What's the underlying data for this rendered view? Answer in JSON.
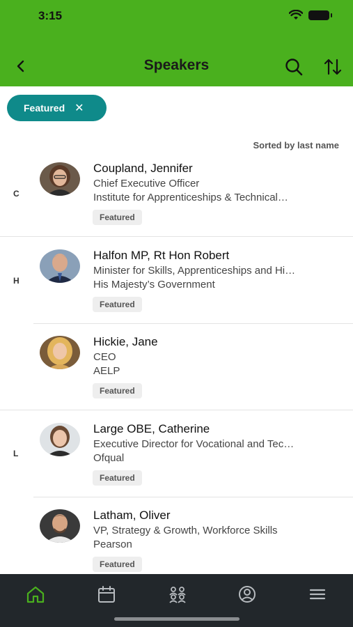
{
  "status_bar": {
    "time": "3:15"
  },
  "header": {
    "title": "Speakers"
  },
  "filter": {
    "label": "Featured",
    "close": "✕"
  },
  "sort_note": "Sorted by last name",
  "sections": [
    {
      "letter": "C"
    },
    {
      "letter": "H"
    },
    {
      "letter": "L"
    }
  ],
  "speakers": [
    {
      "name": "Coupland, Jennifer",
      "role": "Chief Executive Officer",
      "org": "Institute for Apprenticeships & Technical…",
      "badge": "Featured"
    },
    {
      "name": "Halfon MP, Rt Hon Robert",
      "role": "Minister for Skills, Apprenticeships and Hi…",
      "org": "His Majesty’s Government",
      "badge": "Featured"
    },
    {
      "name": "Hickie, Jane",
      "role": "CEO",
      "org": "AELP",
      "badge": "Featured"
    },
    {
      "name": "Large OBE, Catherine",
      "role": "Executive Director for Vocational and Tec…",
      "org": "Ofqual",
      "badge": "Featured"
    },
    {
      "name": "Latham, Oliver",
      "role": "VP, Strategy & Growth, Workforce Skills",
      "org": "Pearson",
      "badge": "Featured"
    }
  ],
  "colors": {
    "header": "#4ab01e",
    "chip": "#0f8a8a",
    "tabbar": "#22272b",
    "active_tab": "#4ab01e"
  },
  "tabs": [
    "home-icon",
    "calendar-icon",
    "people-icon",
    "profile-icon",
    "menu-icon"
  ]
}
